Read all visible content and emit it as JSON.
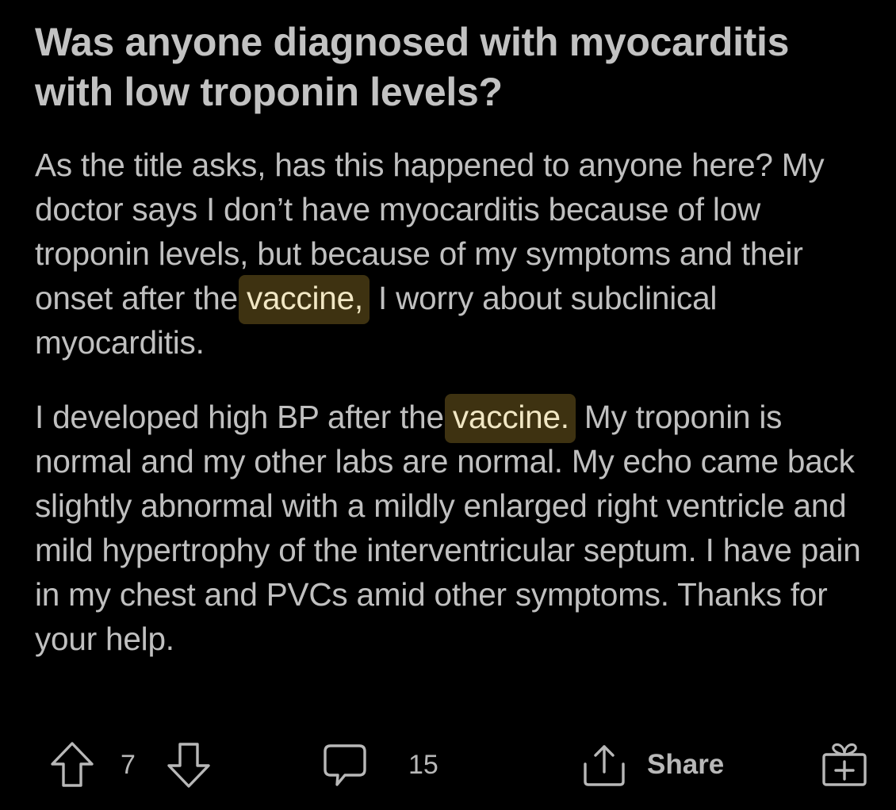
{
  "post": {
    "title": "Was anyone diagnosed with myocarditis with low troponin levels?",
    "paragraph1": {
      "before": "As the title asks, has this happened to anyone here? My doctor says I don’t have myocarditis because of low troponin levels, but because of my symptoms and their onset after the ",
      "highlight": "vaccine,",
      "after": " I worry about subclinical myocarditis."
    },
    "paragraph2": {
      "before": "I developed high BP after the ",
      "highlight": "vaccine.",
      "after": " My troponin is normal and my other labs are normal. My echo came back slightly abnormal with a mildly enlarged right ventricle and mild hypertrophy of the interventricular septum. I have pain in my chest and PVCs amid other symptoms. Thanks for your help."
    }
  },
  "actions": {
    "vote_count": "7",
    "comment_count": "15",
    "share_label": "Share"
  },
  "icons": {
    "upvote": "arrow-up-icon",
    "downvote": "arrow-down-icon",
    "comment": "speech-bubble-icon",
    "share": "share-icon",
    "award": "gift-award-icon"
  },
  "colors": {
    "background": "#000000",
    "text": "#c0c0c0",
    "highlight_bg": "#3e3211",
    "highlight_text": "#f1e7c4"
  }
}
